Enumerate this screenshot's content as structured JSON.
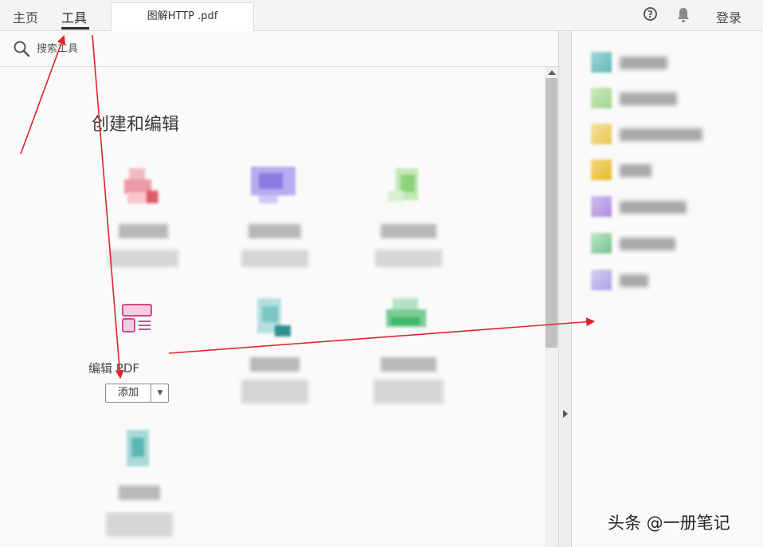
{
  "topbar": {
    "nav_home": "主页",
    "nav_tools": "工具",
    "document_tab": "图解HTTP .pdf",
    "help_symbol": "?",
    "login": "登录"
  },
  "search": {
    "placeholder": "搜索工具",
    "value": ""
  },
  "section": {
    "title": "创建和编辑"
  },
  "featured_tool": {
    "name": "编辑 PDF",
    "add_button": "添加",
    "add_dropdown": "▼",
    "accent_color": "#d6498a"
  },
  "icons": {
    "help": "help-circle-icon",
    "bell": "bell-icon",
    "search": "search-icon",
    "edit_pdf": "edit-pdf-icon",
    "scroll_up": "scroll-up-arrow-icon",
    "collapse": "collapse-right-arrow-icon"
  },
  "colors": {
    "red_annotation": "#e0242a",
    "tool_red": "#e06a78",
    "tool_purple": "#8c7be0",
    "tool_green": "#8ed27a",
    "tool_teal": "#3fa7a8",
    "tool_green2": "#3fb56b",
    "tool_cyan": "#5cb7b5"
  },
  "watermark": "头条 @一册笔记"
}
